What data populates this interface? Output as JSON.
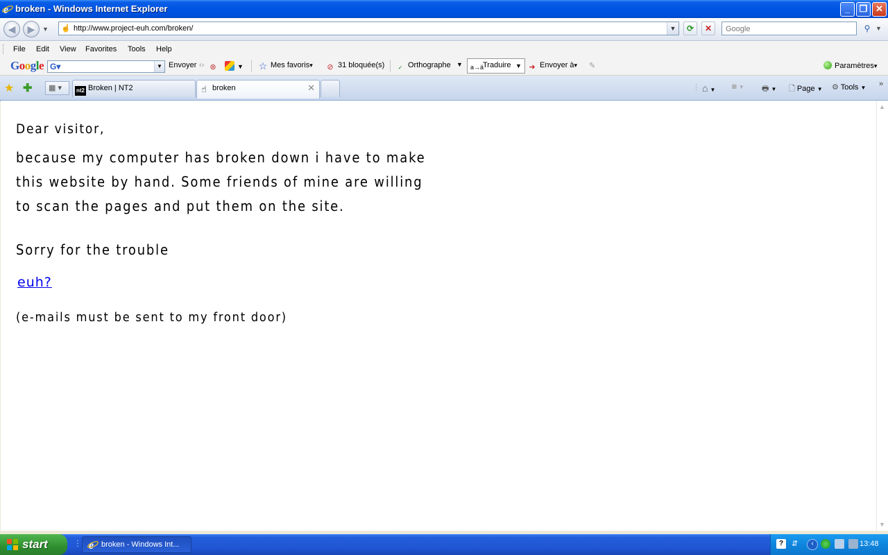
{
  "window": {
    "title": "broken - Windows Internet Explorer"
  },
  "address_bar": {
    "url": "http://www.project-euh.com/broken/"
  },
  "search": {
    "placeholder": "Google"
  },
  "menu": {
    "items": [
      "File",
      "Edit",
      "View",
      "Favorites",
      "Tools",
      "Help"
    ]
  },
  "google_toolbar": {
    "logo": "Google",
    "envoyer": "Envoyer",
    "mes_favoris": "Mes favoris",
    "bloquees": "31 bloquée(s)",
    "orthographe": "Orthographe",
    "traduire": "Traduire",
    "envoyer_a": "Envoyer à",
    "parametres": "Paramètres"
  },
  "tabs": [
    {
      "label": "Broken | NT2",
      "icon": "nt2-icon"
    },
    {
      "label": "broken",
      "icon": "hand-icon",
      "active": true
    }
  ],
  "command_bar": {
    "page": "Page",
    "tools": "Tools"
  },
  "content": {
    "greeting": "Dear visitor,",
    "paragraph_lines": [
      "because my computer has broken down i have to make",
      "this website by hand. Some friends of mine are willing",
      "to scan the pages and put them on the site."
    ],
    "apology": "Sorry for the trouble",
    "link": "euh?",
    "email_note": "(e-mails must be sent to my front door)"
  },
  "taskbar": {
    "start": "start",
    "task": "broken - Windows Int...",
    "clock": "13:48"
  },
  "colors": {
    "titlebar": "#0054e3",
    "taskbar": "#245edb",
    "start": "#2f8f2f",
    "link": "#0000ee"
  }
}
